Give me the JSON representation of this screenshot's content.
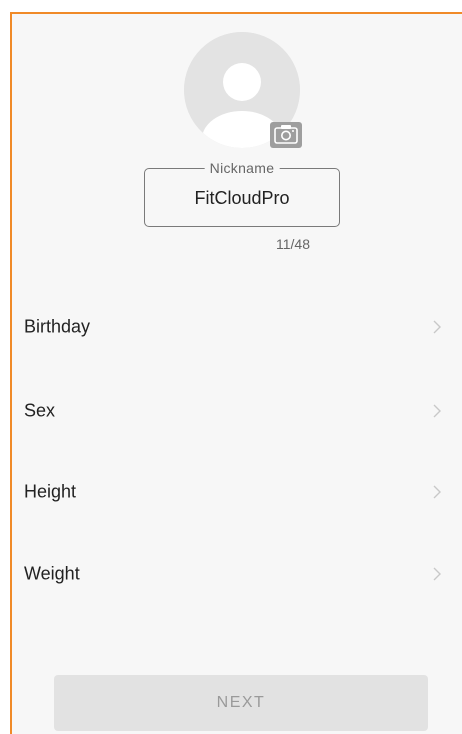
{
  "profile": {
    "avatar_icon": "default-user-avatar",
    "camera_icon": "camera-icon",
    "nickname": {
      "label": "Nickname",
      "value": "FitCloudPro",
      "counter": "11/48"
    }
  },
  "fields": [
    {
      "label": "Birthday",
      "icon": "chevron-right-icon"
    },
    {
      "label": "Sex",
      "icon": "chevron-right-icon"
    },
    {
      "label": "Height",
      "icon": "chevron-right-icon"
    },
    {
      "label": "Weight",
      "icon": "chevron-right-icon"
    }
  ],
  "next_button": {
    "label": "NEXT"
  },
  "colors": {
    "frame_accent": "#f08a28",
    "background": "#f7f7f7",
    "disabled_button": "#e2e2e2",
    "disabled_text": "#9a9a9a"
  }
}
